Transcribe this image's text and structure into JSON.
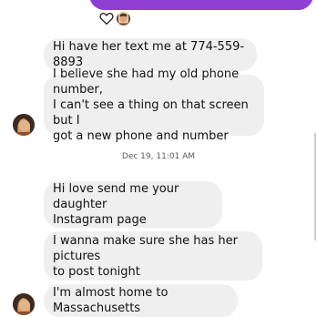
{
  "thread": {
    "messages": [
      {
        "text": "Hi have her text me at 774-559-8893"
      },
      {
        "text": "I believe she had my old phone number,\nI can't see a thing on that screen but I\ngot a new phone and number"
      },
      {
        "text": "Hi love send me your daughter\nInstagram page"
      },
      {
        "text": "I wanna make sure she has her pictures\nto post tonight"
      },
      {
        "text": "I'm almost home to Massachusetts"
      }
    ],
    "timestamp": "Dec 19, 11:01 AM"
  },
  "reaction": {
    "icon": "heart-outline-icon"
  },
  "colors": {
    "sent_bubble": "#8f3fd4",
    "received_bubble": "#efefef"
  }
}
